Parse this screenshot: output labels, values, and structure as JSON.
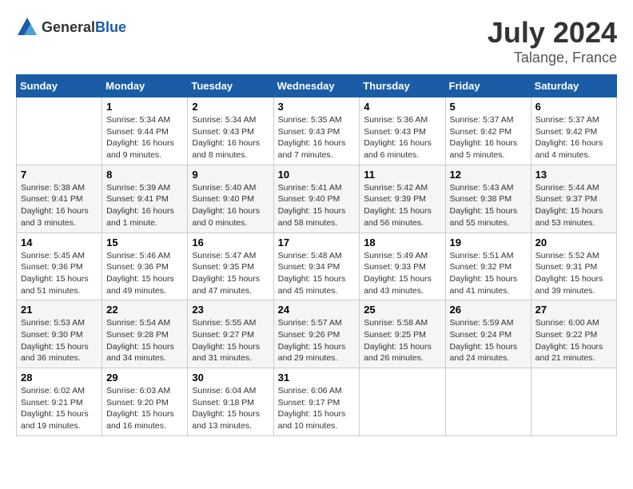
{
  "header": {
    "logo_general": "General",
    "logo_blue": "Blue",
    "month": "July 2024",
    "location": "Talange, France"
  },
  "weekdays": [
    "Sunday",
    "Monday",
    "Tuesday",
    "Wednesday",
    "Thursday",
    "Friday",
    "Saturday"
  ],
  "weeks": [
    [
      {
        "day": "",
        "sunrise": "",
        "sunset": "",
        "daylight": ""
      },
      {
        "day": "1",
        "sunrise": "Sunrise: 5:34 AM",
        "sunset": "Sunset: 9:44 PM",
        "daylight": "Daylight: 16 hours and 9 minutes."
      },
      {
        "day": "2",
        "sunrise": "Sunrise: 5:34 AM",
        "sunset": "Sunset: 9:43 PM",
        "daylight": "Daylight: 16 hours and 8 minutes."
      },
      {
        "day": "3",
        "sunrise": "Sunrise: 5:35 AM",
        "sunset": "Sunset: 9:43 PM",
        "daylight": "Daylight: 16 hours and 7 minutes."
      },
      {
        "day": "4",
        "sunrise": "Sunrise: 5:36 AM",
        "sunset": "Sunset: 9:43 PM",
        "daylight": "Daylight: 16 hours and 6 minutes."
      },
      {
        "day": "5",
        "sunrise": "Sunrise: 5:37 AM",
        "sunset": "Sunset: 9:42 PM",
        "daylight": "Daylight: 16 hours and 5 minutes."
      },
      {
        "day": "6",
        "sunrise": "Sunrise: 5:37 AM",
        "sunset": "Sunset: 9:42 PM",
        "daylight": "Daylight: 16 hours and 4 minutes."
      }
    ],
    [
      {
        "day": "7",
        "sunrise": "Sunrise: 5:38 AM",
        "sunset": "Sunset: 9:41 PM",
        "daylight": "Daylight: 16 hours and 3 minutes."
      },
      {
        "day": "8",
        "sunrise": "Sunrise: 5:39 AM",
        "sunset": "Sunset: 9:41 PM",
        "daylight": "Daylight: 16 hours and 1 minute."
      },
      {
        "day": "9",
        "sunrise": "Sunrise: 5:40 AM",
        "sunset": "Sunset: 9:40 PM",
        "daylight": "Daylight: 16 hours and 0 minutes."
      },
      {
        "day": "10",
        "sunrise": "Sunrise: 5:41 AM",
        "sunset": "Sunset: 9:40 PM",
        "daylight": "Daylight: 15 hours and 58 minutes."
      },
      {
        "day": "11",
        "sunrise": "Sunrise: 5:42 AM",
        "sunset": "Sunset: 9:39 PM",
        "daylight": "Daylight: 15 hours and 56 minutes."
      },
      {
        "day": "12",
        "sunrise": "Sunrise: 5:43 AM",
        "sunset": "Sunset: 9:38 PM",
        "daylight": "Daylight: 15 hours and 55 minutes."
      },
      {
        "day": "13",
        "sunrise": "Sunrise: 5:44 AM",
        "sunset": "Sunset: 9:37 PM",
        "daylight": "Daylight: 15 hours and 53 minutes."
      }
    ],
    [
      {
        "day": "14",
        "sunrise": "Sunrise: 5:45 AM",
        "sunset": "Sunset: 9:36 PM",
        "daylight": "Daylight: 15 hours and 51 minutes."
      },
      {
        "day": "15",
        "sunrise": "Sunrise: 5:46 AM",
        "sunset": "Sunset: 9:36 PM",
        "daylight": "Daylight: 15 hours and 49 minutes."
      },
      {
        "day": "16",
        "sunrise": "Sunrise: 5:47 AM",
        "sunset": "Sunset: 9:35 PM",
        "daylight": "Daylight: 15 hours and 47 minutes."
      },
      {
        "day": "17",
        "sunrise": "Sunrise: 5:48 AM",
        "sunset": "Sunset: 9:34 PM",
        "daylight": "Daylight: 15 hours and 45 minutes."
      },
      {
        "day": "18",
        "sunrise": "Sunrise: 5:49 AM",
        "sunset": "Sunset: 9:33 PM",
        "daylight": "Daylight: 15 hours and 43 minutes."
      },
      {
        "day": "19",
        "sunrise": "Sunrise: 5:51 AM",
        "sunset": "Sunset: 9:32 PM",
        "daylight": "Daylight: 15 hours and 41 minutes."
      },
      {
        "day": "20",
        "sunrise": "Sunrise: 5:52 AM",
        "sunset": "Sunset: 9:31 PM",
        "daylight": "Daylight: 15 hours and 39 minutes."
      }
    ],
    [
      {
        "day": "21",
        "sunrise": "Sunrise: 5:53 AM",
        "sunset": "Sunset: 9:30 PM",
        "daylight": "Daylight: 15 hours and 36 minutes."
      },
      {
        "day": "22",
        "sunrise": "Sunrise: 5:54 AM",
        "sunset": "Sunset: 9:28 PM",
        "daylight": "Daylight: 15 hours and 34 minutes."
      },
      {
        "day": "23",
        "sunrise": "Sunrise: 5:55 AM",
        "sunset": "Sunset: 9:27 PM",
        "daylight": "Daylight: 15 hours and 31 minutes."
      },
      {
        "day": "24",
        "sunrise": "Sunrise: 5:57 AM",
        "sunset": "Sunset: 9:26 PM",
        "daylight": "Daylight: 15 hours and 29 minutes."
      },
      {
        "day": "25",
        "sunrise": "Sunrise: 5:58 AM",
        "sunset": "Sunset: 9:25 PM",
        "daylight": "Daylight: 15 hours and 26 minutes."
      },
      {
        "day": "26",
        "sunrise": "Sunrise: 5:59 AM",
        "sunset": "Sunset: 9:24 PM",
        "daylight": "Daylight: 15 hours and 24 minutes."
      },
      {
        "day": "27",
        "sunrise": "Sunrise: 6:00 AM",
        "sunset": "Sunset: 9:22 PM",
        "daylight": "Daylight: 15 hours and 21 minutes."
      }
    ],
    [
      {
        "day": "28",
        "sunrise": "Sunrise: 6:02 AM",
        "sunset": "Sunset: 9:21 PM",
        "daylight": "Daylight: 15 hours and 19 minutes."
      },
      {
        "day": "29",
        "sunrise": "Sunrise: 6:03 AM",
        "sunset": "Sunset: 9:20 PM",
        "daylight": "Daylight: 15 hours and 16 minutes."
      },
      {
        "day": "30",
        "sunrise": "Sunrise: 6:04 AM",
        "sunset": "Sunset: 9:18 PM",
        "daylight": "Daylight: 15 hours and 13 minutes."
      },
      {
        "day": "31",
        "sunrise": "Sunrise: 6:06 AM",
        "sunset": "Sunset: 9:17 PM",
        "daylight": "Daylight: 15 hours and 10 minutes."
      },
      {
        "day": "",
        "sunrise": "",
        "sunset": "",
        "daylight": ""
      },
      {
        "day": "",
        "sunrise": "",
        "sunset": "",
        "daylight": ""
      },
      {
        "day": "",
        "sunrise": "",
        "sunset": "",
        "daylight": ""
      }
    ]
  ]
}
